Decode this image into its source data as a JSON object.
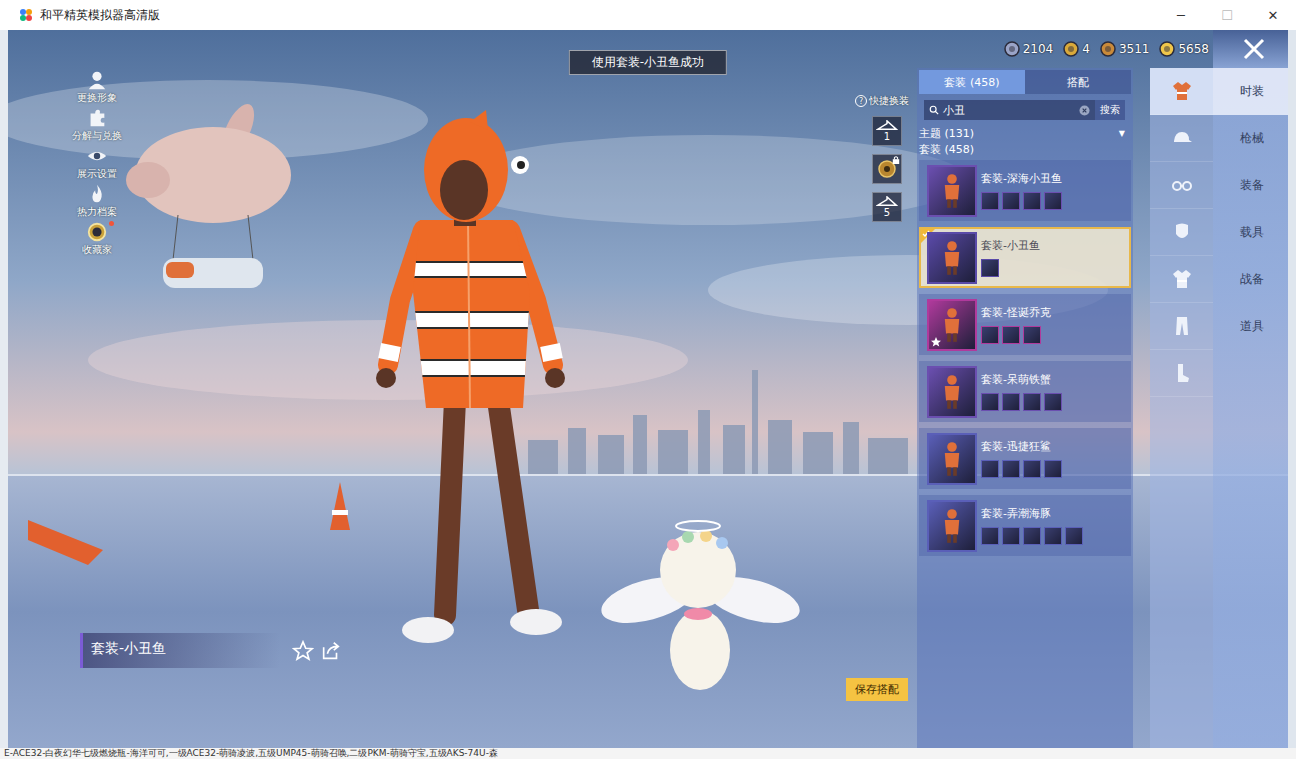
{
  "window": {
    "title": "和平精英模拟器高清版",
    "controls": [
      {
        "glyph": "─",
        "disabled": false
      },
      {
        "glyph": "☐",
        "disabled": true
      },
      {
        "glyph": "✕",
        "disabled": false
      }
    ]
  },
  "toast": "使用套装-小丑鱼成功",
  "currencies": [
    {
      "amount": "2104",
      "color": "#9aa4c8"
    },
    {
      "amount": "4",
      "color": "#d9a93a"
    },
    {
      "amount": "3511",
      "color": "#c98a3a"
    },
    {
      "amount": "5658",
      "color": "#f0c64a"
    }
  ],
  "left_menu": [
    {
      "label": "更换形象",
      "kind": "person",
      "dot": false
    },
    {
      "label": "分解与兑换",
      "kind": "puzzle",
      "dot": false
    },
    {
      "label": "展示设置",
      "kind": "eye",
      "dot": false
    },
    {
      "label": "热力档案",
      "kind": "fire",
      "dot": false
    },
    {
      "label": "收藏家",
      "kind": "medal",
      "dot": true
    }
  ],
  "quick_change": {
    "help": "?",
    "label": "快捷换装",
    "slots": [
      {
        "kind": "hanger",
        "label": "1",
        "locked": false
      },
      {
        "kind": "badge",
        "label": "",
        "locked": true
      },
      {
        "kind": "hanger",
        "label": "5",
        "locked": false
      }
    ]
  },
  "panel": {
    "tabs": [
      {
        "label": "套装 (458)",
        "selected": true
      },
      {
        "label": "搭配",
        "selected": false
      }
    ],
    "search": {
      "value": "小丑",
      "button": "搜索"
    },
    "filter": {
      "label": "主题 (131)",
      "arrow": "▼"
    },
    "section": "套装 (458)",
    "outfits": [
      {
        "name": "套装-深海小丑鱼",
        "selected": false,
        "starred": false,
        "pieces": 4,
        "color": "#6b4fb0"
      },
      {
        "name": "套装-小丑鱼",
        "selected": true,
        "starred": false,
        "pieces": 1,
        "color": "#5a4aa8"
      },
      {
        "name": "套装-怪诞乔克",
        "selected": false,
        "starred": true,
        "pieces": 3,
        "color": "#b03a9c"
      },
      {
        "name": "套装-呆萌铁蟹",
        "selected": false,
        "starred": false,
        "pieces": 4,
        "color": "#6b4fb0"
      },
      {
        "name": "套装-迅捷狂鲨",
        "selected": false,
        "starred": false,
        "pieces": 4,
        "color": "#5a5fb8"
      },
      {
        "name": "套装-弄潮海豚",
        "selected": false,
        "starred": false,
        "pieces": 5,
        "color": "#5a5fb8"
      }
    ]
  },
  "categories": [
    {
      "kind": "suit",
      "selected": true
    },
    {
      "kind": "hat",
      "selected": false
    },
    {
      "kind": "glasses",
      "selected": false
    },
    {
      "kind": "mask",
      "selected": false
    },
    {
      "kind": "suit",
      "selected": false
    },
    {
      "kind": "pants",
      "selected": false
    },
    {
      "kind": "socks",
      "selected": false
    }
  ],
  "nav": [
    {
      "label": "时装",
      "selected": true
    },
    {
      "label": "枪械",
      "selected": false
    },
    {
      "label": "装备",
      "selected": false
    },
    {
      "label": "载具",
      "selected": false
    },
    {
      "label": "战备",
      "selected": false
    },
    {
      "label": "道具",
      "selected": false
    }
  ],
  "current_outfit": {
    "name": "套装-小丑鱼"
  },
  "save_button": "保存搭配",
  "background_window": {
    "text": "E-ACE32-白夜幻华七级燃烧瓶-海洋可可,一级ACE32-萌骑凌波,五级UMP45-萌骑召唤,二级PKM-萌骑守宝,五级AKS-74U-森"
  }
}
